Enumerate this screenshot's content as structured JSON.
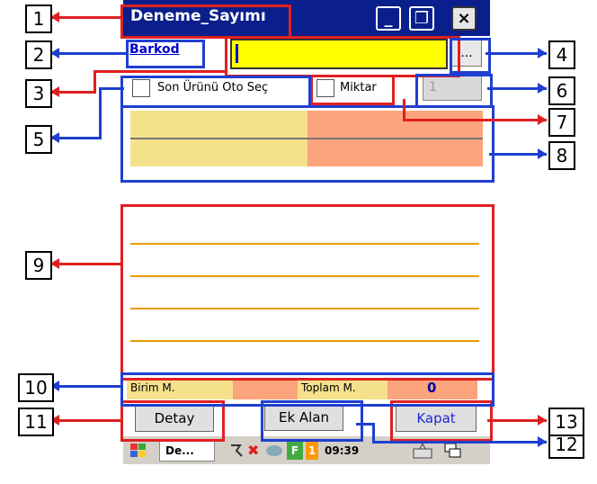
{
  "window": {
    "title": "Deneme_Sayımı",
    "btn_min": "_",
    "btn_restore": "❐",
    "btn_close": "×"
  },
  "form": {
    "barcode_label": "Barkod",
    "barcode_value": "",
    "browse_label": "...",
    "auto_select_label": "Son Ürünü  Oto Seç",
    "quantity_check_label": "Miktar",
    "quantity_value": "1"
  },
  "summary": {
    "unit_label": "Birim M.",
    "total_label": "Toplam M.",
    "total_value": "0"
  },
  "buttons": {
    "detail": "Detay",
    "extra_field": "Ek Alan",
    "close": "Kapat"
  },
  "taskbar": {
    "task_label": "De...",
    "clock": "09:39",
    "badge": "1",
    "f_badge": "F"
  },
  "annotations": [
    "1",
    "2",
    "3",
    "4",
    "5",
    "6",
    "7",
    "8",
    "9",
    "10",
    "11",
    "12",
    "13"
  ],
  "colors": {
    "title_bar": "#0a1f8c",
    "barcode_bg": "#ffff00",
    "beige": "#f5e18c",
    "salmon": "#fca47c",
    "annotation_red": "#e02020",
    "annotation_blue": "#1f3fd0"
  }
}
